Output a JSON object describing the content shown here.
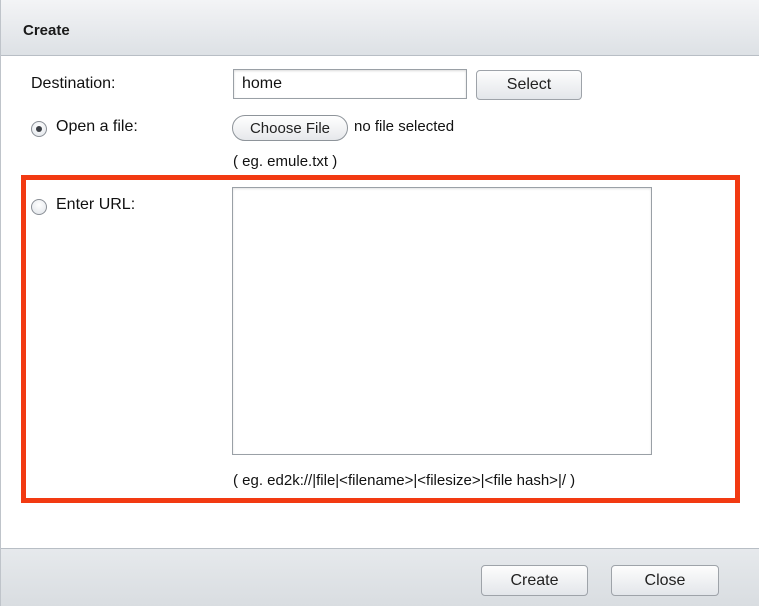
{
  "dialog": {
    "title": "Create"
  },
  "form": {
    "destination_label": "Destination:",
    "destination_value": "home",
    "select_button": "Select",
    "open_file_label": "Open a file:",
    "open_file_checked": true,
    "choose_file_button": "Choose File",
    "no_file_text": "no file selected",
    "file_example": "( eg. emule.txt )",
    "enter_url_label": "Enter URL:",
    "enter_url_checked": false,
    "url_value": "",
    "url_example": "( eg. ed2k://|file|<filename>|<filesize>|<file hash>|/ )"
  },
  "footer": {
    "create_button": "Create",
    "close_button": "Close"
  },
  "colors": {
    "highlight_border": "#f23a12",
    "titlebar_bg": "#e6e9ec"
  }
}
